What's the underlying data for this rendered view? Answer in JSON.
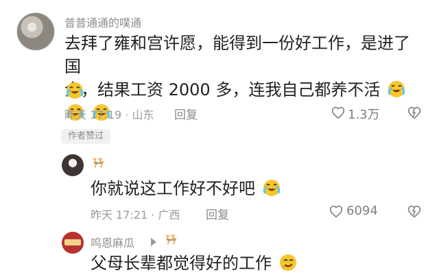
{
  "comment_main": {
    "username": "普普通通的噗通",
    "text_line1": "去拜了雍和宫许愿，能得到一份好工作，是进了国",
    "text_line2": "企，结果工资 2000 多，连我自己都养不活",
    "meta_time": "昨天 17:19 · 山东",
    "reply_label": "回复",
    "like_count": "1.3万",
    "author_badge": "作者赞过",
    "emoji_icon": "laughing-crying-emoji-icon"
  },
  "reply_one": {
    "text": "你就说这工作好不好吧",
    "meta_time": "昨天 17:21 · 广西",
    "reply_label": "回复",
    "like_count": "6094",
    "emoji_icon": "laughing-crying-emoji-icon"
  },
  "reply_two": {
    "username": "呜恩麻瓜",
    "text": "父母长辈都觉得好的工作",
    "emoji_icon": "smirk-emoji-icon"
  },
  "icons": {
    "heart": "heart-icon",
    "broken_heart": "broken-heart-icon",
    "author_sign": "author-sign-icon",
    "arrow": "reply-arrow-icon"
  },
  "colors": {
    "emoji_yellow": "#f6c62f",
    "emoji_blue": "#5cc8f3",
    "text_dark": "#222222",
    "text_gray": "#9a9a9a"
  }
}
